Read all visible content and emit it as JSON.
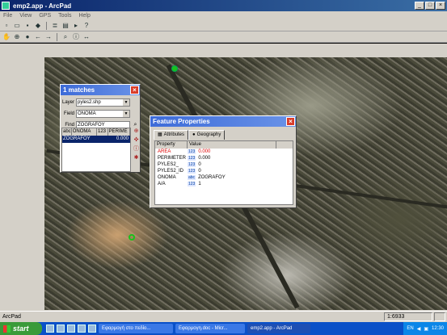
{
  "window": {
    "title": "emp2.app - ArcPad",
    "controls": [
      "_",
      "□",
      "×"
    ]
  },
  "menu": [
    "File",
    "View",
    "GPS",
    "Tools",
    "Help"
  ],
  "toolbar1_icons": [
    "new-icon",
    "open-icon",
    "save-icon",
    "add-layer-icon",
    "layer-icon",
    "folder-icon",
    "bookmark-icon",
    "help-icon"
  ],
  "toolbar2_icons": [
    "pan-icon",
    "zoom-icon",
    "globe-icon",
    "back-icon",
    "forward-icon",
    "find-icon",
    "identify-icon",
    "measure-icon"
  ],
  "map_points": [
    {
      "name": "green-point-1",
      "style": "solid"
    },
    {
      "name": "green-point-2",
      "style": "ring"
    }
  ],
  "matches_dialog": {
    "title": "1 matches",
    "layer_label": "Layer",
    "layer_value": "pyles2.shp",
    "field_label": "Field",
    "field_value": "ONOMA",
    "find_label": "Find",
    "find_value": "ZOGRAFOY",
    "columns": [
      "abc",
      "ONOMA",
      "123",
      "PERIME"
    ],
    "rows": [
      {
        "onoma": "ZOGRAFOY",
        "perimeter": "0.000"
      }
    ]
  },
  "feature_properties": {
    "title": "Feature Properties",
    "tabs": [
      "Attributes",
      "Geography"
    ],
    "columns": [
      "Property",
      "Value"
    ],
    "rows": [
      {
        "property": "AREA",
        "type": "123",
        "value": "0.000",
        "highlight": true
      },
      {
        "property": "PERIMETER",
        "type": "123",
        "value": "0.000",
        "highlight": false
      },
      {
        "property": "PYLES2_",
        "type": "123",
        "value": "0",
        "highlight": false
      },
      {
        "property": "PYLES2_ID",
        "type": "123",
        "value": "0",
        "highlight": false
      },
      {
        "property": "ONOMA",
        "type": "abc",
        "value": "ZOGRAFOY",
        "highlight": false
      },
      {
        "property": "A/A",
        "type": "123",
        "value": "1",
        "highlight": false
      }
    ]
  },
  "status": {
    "left": "ArcPad",
    "scale": "1:6933"
  },
  "taskbar": {
    "start": "start",
    "tasks": [
      {
        "label": "Εφαρμογή στο πεδίο...",
        "active": false
      },
      {
        "label": "Εφαρμογη.doc - Micr...",
        "active": false
      },
      {
        "label": "emp2.app - ArcPad",
        "active": true
      }
    ],
    "lang": "EN",
    "clock": "12:30"
  },
  "colors": {
    "titlebar": "#0a246a",
    "point": "#19c21a",
    "highlight": "#d00000",
    "selection": "#0a246a"
  }
}
